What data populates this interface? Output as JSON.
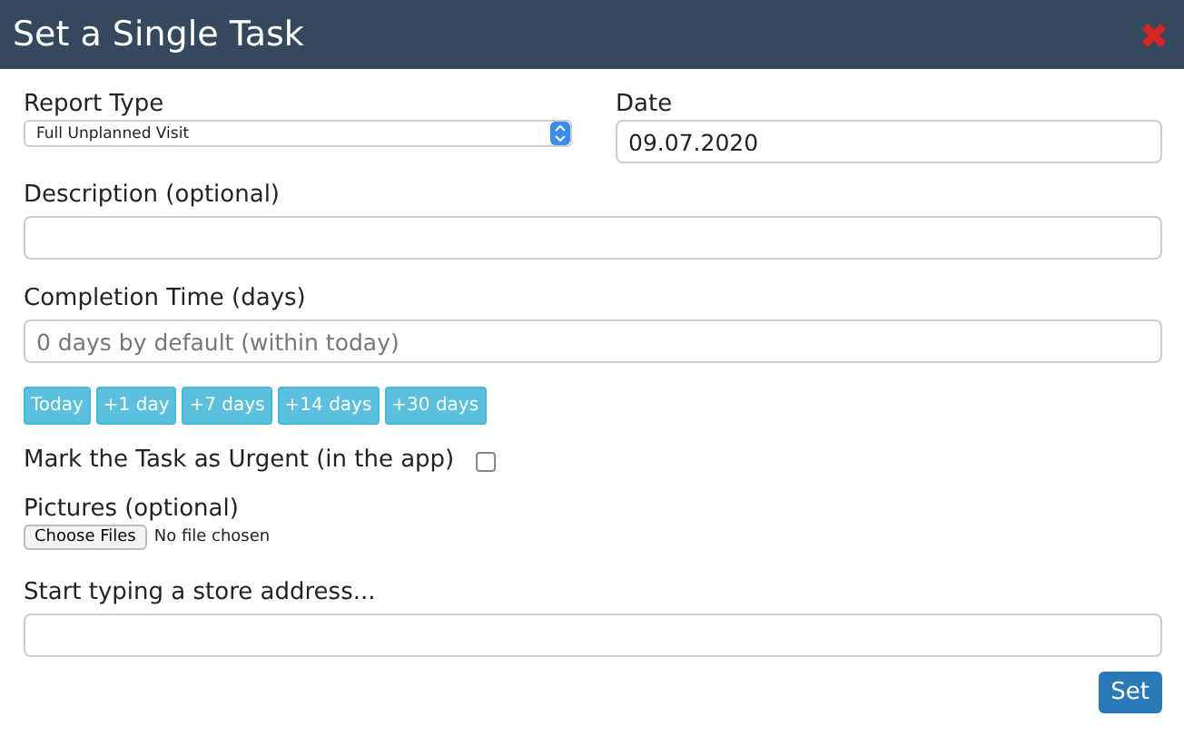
{
  "window": {
    "title": "Set a Single Task"
  },
  "report_type": {
    "label": "Report Type",
    "value": "Full Unplanned Visit"
  },
  "date": {
    "label": "Date",
    "value": "09.07.2020"
  },
  "description": {
    "label": "Description (optional)"
  },
  "completion_time": {
    "label": "Completion Time (days)",
    "placeholder": "0 days by default (within today)"
  },
  "quick_buttons": [
    "Today",
    "+1 day",
    "+7 days",
    "+14 days",
    "+30 days"
  ],
  "urgent": {
    "label": "Mark the Task as Urgent (in the app)",
    "checked": false
  },
  "pictures": {
    "label": "Pictures (optional)",
    "button": "Choose Files",
    "status": "No file chosen"
  },
  "address": {
    "label": "Start typing a store address..."
  },
  "submit": "Set"
}
